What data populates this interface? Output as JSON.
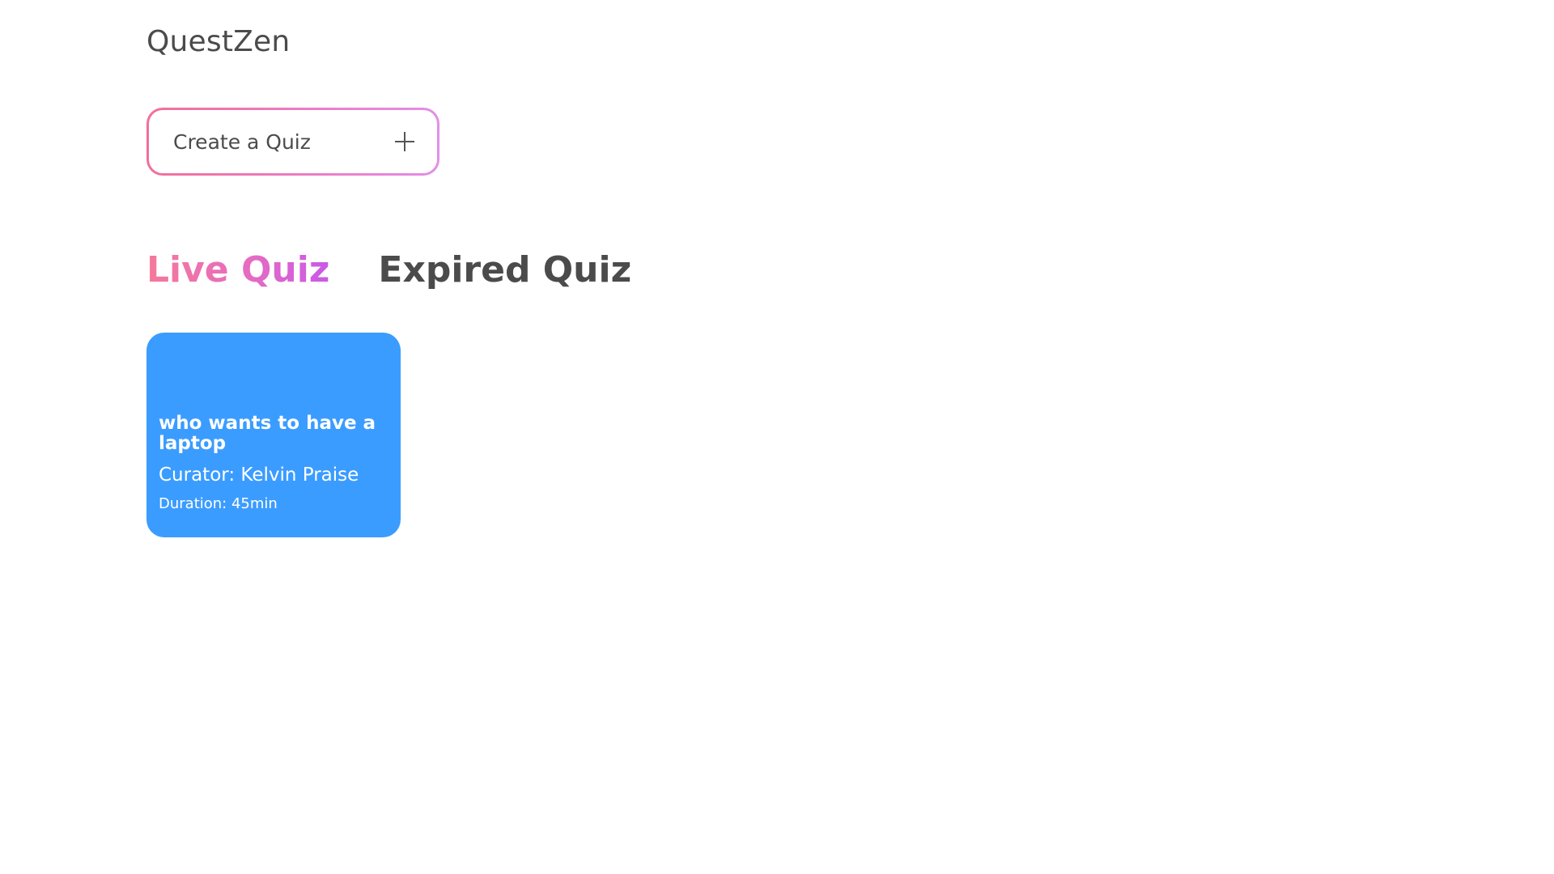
{
  "app": {
    "name": "QuestZen"
  },
  "actions": {
    "create_quiz_label": "Create a Quiz",
    "create_quiz_icon": "plus-icon"
  },
  "tabs": [
    {
      "label": "Live Quiz",
      "active": true
    },
    {
      "label": "Expired Quiz",
      "active": false
    }
  ],
  "quizzes": [
    {
      "title": "who wants to have a laptop",
      "curator": "Curator: Kelvin Praise",
      "duration": "Duration: 45min"
    }
  ],
  "colors": {
    "card_background": "#3b9cff",
    "accent_gradient_start": "#f5799a",
    "accent_gradient_end": "#c959e8",
    "text_dark": "#4b4b4b"
  }
}
